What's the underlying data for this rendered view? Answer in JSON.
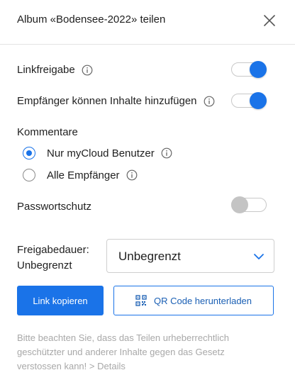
{
  "dialog": {
    "title": "Album «Bodensee-2022» teilen",
    "close_icon": "close-icon"
  },
  "link_share": {
    "label": "Linkfreigabe",
    "enabled": true
  },
  "recipients_add": {
    "label": "Empfänger können Inhalte hinzufügen",
    "enabled": true
  },
  "comments": {
    "label": "Kommentare",
    "options": [
      {
        "label": "Nur myCloud Benutzer",
        "selected": true
      },
      {
        "label": "Alle Empfänger",
        "selected": false
      }
    ]
  },
  "password": {
    "label": "Passwortschutz",
    "enabled": false
  },
  "duration": {
    "label_line1": "Freigabedauer:",
    "label_line2": "Unbegrenzt",
    "select_value": "Unbegrenzt"
  },
  "buttons": {
    "copy_link": "Link kopieren",
    "qr_download": "QR Code herunterladen"
  },
  "notice": {
    "text": "Bitte beachten Sie, dass das Teilen urheberrechtlich geschützter und anderer Inhalte gegen das Gesetz verstossen kann!",
    "link": "> Details"
  },
  "colors": {
    "accent": "#1a73e8",
    "toggle_off": "#c4c4c4",
    "muted_text": "#a8a8a8"
  }
}
